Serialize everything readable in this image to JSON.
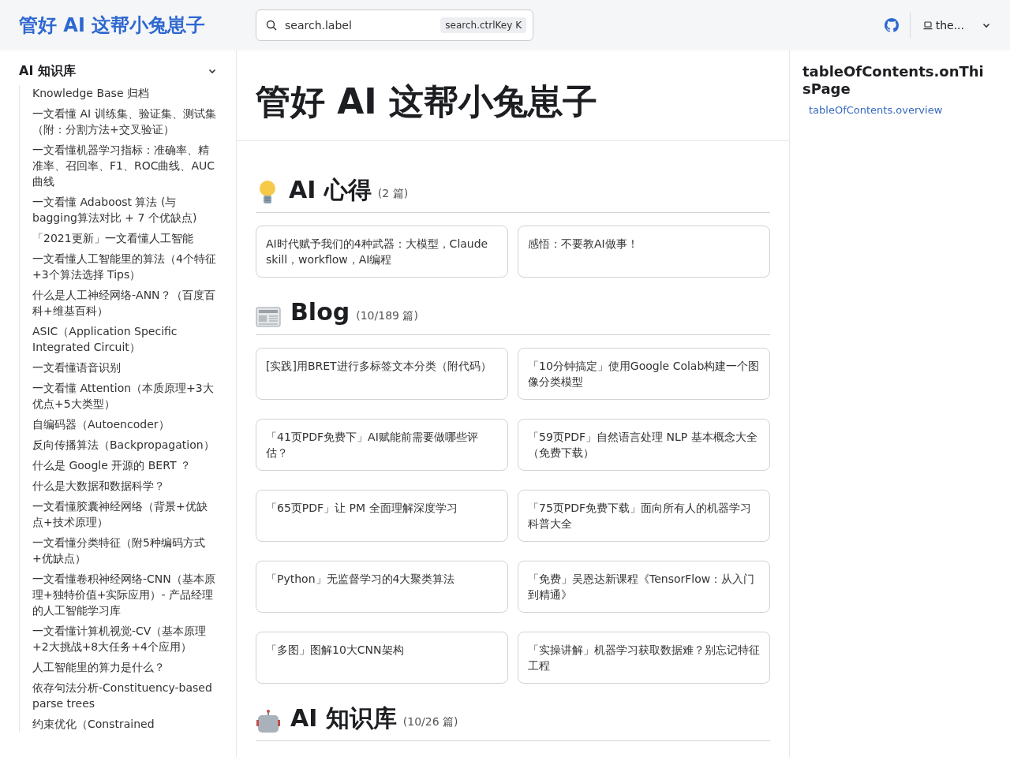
{
  "header": {
    "site_title": "管好 AI 这帮小兔崽子",
    "search": {
      "placeholder": "search.label",
      "shortcut": "search.ctrlKey K"
    },
    "theme_button": {
      "label": "the..."
    }
  },
  "sidebar": {
    "category": {
      "label": "AI 知识库",
      "expanded": true
    },
    "items": [
      "Knowledge Base 归档",
      "一文看懂 AI 训练集、验证集、测试集（附：分割方法+交叉验证）",
      "一文看懂机器学习指标：准确率、精准率、召回率、F1、ROC曲线、AUC曲线",
      "一文看懂 Adaboost 算法 (与bagging算法对比 + 7 个优缺点)",
      "「2021更新」一文看懂人工智能",
      "一文看懂人工智能里的算法（4个特征+3个算法选择 Tips）",
      "什么是人工神经网络-ANN？（百度百科+维基百科）",
      "ASIC（Application Specific Integrated Circuit）",
      "一文看懂语音识别",
      "一文看懂 Attention（本质原理+3大优点+5大类型）",
      "自编码器（Autoencoder）",
      "反向传播算法（Backpropagation）",
      "什么是 Google 开源的 BERT ？",
      "什么是大数据和数据科学？",
      "一文看懂胶囊神经网络（背景+优缺点+技术原理）",
      "一文看懂分类特征（附5种编码方式+优缺点）",
      "一文看懂卷积神经网络-CNN（基本原理+独特价值+实际应用）- 产品经理的人工智能学习库",
      "一文看懂计算机视觉-CV（基本原理+2大挑战+8大任务+4个应用）",
      "人工智能里的算力是什么？",
      "依存句法分析-Constituency-based parse trees",
      "约束优化（Constrained"
    ]
  },
  "page_title": "管好 AI 这帮小兔崽子",
  "sections": [
    {
      "kind": "bulb",
      "title": "AI 心得",
      "count": "(2 篇)",
      "cards": [
        "AI时代赋予我们的4种武器：大模型，Claude skill，workflow，AI编程",
        "感悟：不要教AI做事！"
      ]
    },
    {
      "kind": "newspaper",
      "title": "Blog",
      "count": "(10/189 篇)",
      "cards": [
        "[实践]用BRET进行多标签文本分类（附代码）",
        "「10分钟搞定」使用Google Colab构建一个图像分类模型",
        "「41页PDF免费下」AI赋能前需要做哪些评估？",
        "「59页PDF」自然语言处理 NLP 基本概念大全（免费下载）",
        "「65页PDF」让 PM 全面理解深度学习",
        "「75页PDF免费下载」面向所有人的机器学习科普大全",
        "「Python」无监督学习的4大聚类算法",
        "「免费」吴恩达新课程《TensorFlow：从入门到精通》",
        "「多图」图解10大CNN架构",
        "「实操讲解」机器学习获取数据难？别忘记特征工程"
      ]
    },
    {
      "kind": "robot",
      "title": "AI 知识库",
      "count": "(10/26 篇)"
    }
  ],
  "toc": {
    "title": "tableOfContents.onThisPage",
    "links": [
      "tableOfContents.overview"
    ]
  }
}
